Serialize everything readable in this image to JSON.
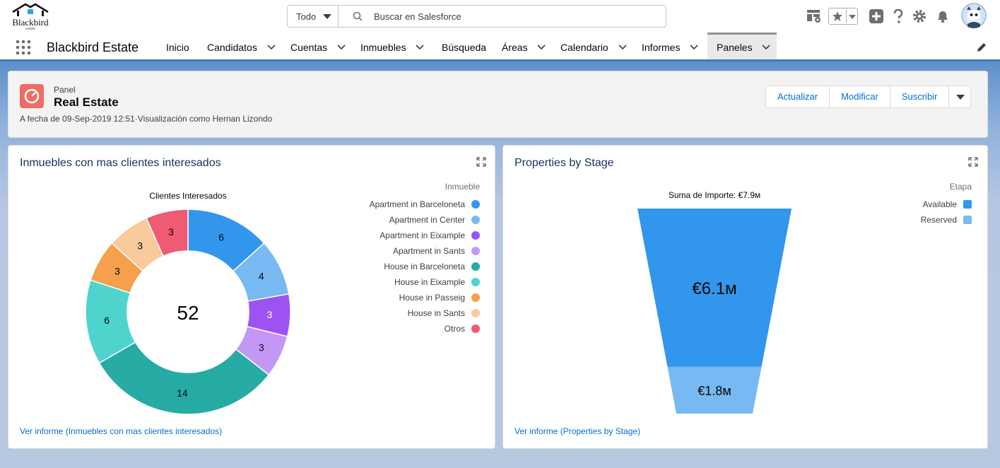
{
  "header": {
    "logo_text": "Blackbird",
    "logo_sub": "estate",
    "search_scope": "Todo",
    "search_placeholder": "Buscar en Salesforce"
  },
  "nav": {
    "app_name": "Blackbird Estate",
    "items": [
      {
        "label": "Inicio",
        "has_menu": false
      },
      {
        "label": "Candidatos",
        "has_menu": true
      },
      {
        "label": "Cuentas",
        "has_menu": true
      },
      {
        "label": "Inmuebles",
        "has_menu": true
      },
      {
        "label": "Búsqueda",
        "has_menu": false
      },
      {
        "label": "Áreas",
        "has_menu": true
      },
      {
        "label": "Calendario",
        "has_menu": true
      },
      {
        "label": "Informes",
        "has_menu": true
      },
      {
        "label": "Paneles",
        "has_menu": true,
        "active": true
      }
    ]
  },
  "dashboard": {
    "eyebrow": "Panel",
    "title": "Real Estate",
    "meta": "A fecha de 09-Sep-2019 12:51·Visualización como Hernan Lizondo",
    "buttons": [
      "Actualizar",
      "Modificar",
      "Suscribir"
    ]
  },
  "cards": {
    "left": {
      "title": "Inmuebles con mas clientes interesados",
      "footer": "Ver informe (Inmuebles con mas clientes interesados)"
    },
    "right": {
      "title": "Properties by Stage",
      "footer": "Ver informe (Properties by Stage)"
    }
  },
  "chart_data": [
    {
      "type": "donut",
      "title": "Clientes Interesados",
      "total": "52",
      "legend_title": "Inmueble",
      "legend_placement": "right",
      "categories": [
        "Apartment in Barceloneta",
        "Apartment in Center",
        "Apartment in Eixample",
        "Apartment in Sants",
        "House in Barceloneta",
        "House in Eixample",
        "House in Passeig",
        "House in Sants",
        "Otros"
      ],
      "values": [
        6,
        4,
        3,
        3,
        14,
        6,
        3,
        3,
        3
      ],
      "colors": [
        "#3296ed",
        "#77b9f2",
        "#9d53f2",
        "#c398f5",
        "#26aba4",
        "#4ed4cd",
        "#f4a04c",
        "#f9ca9b",
        "#ef5b72"
      ]
    },
    {
      "type": "funnel",
      "title": "Suma de Importe: €7.9м",
      "legend_title": "Etapa",
      "legend_placement": "right",
      "categories": [
        "Available",
        "Reserved"
      ],
      "values": [
        6.1,
        1.8
      ],
      "labels": [
        "€6.1м",
        "€1.8м"
      ],
      "colors": [
        "#3296ed",
        "#77b9f2"
      ]
    }
  ]
}
